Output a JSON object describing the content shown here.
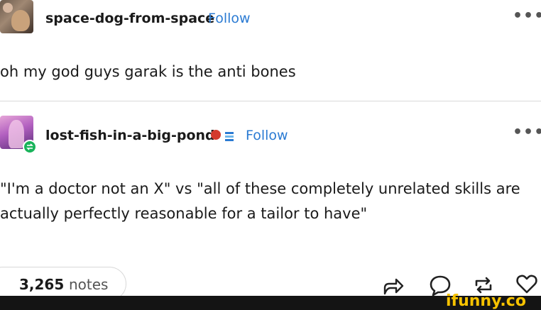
{
  "post": {
    "author": "space-dog-from-space",
    "follow_label": "Follow",
    "more_label": "•••",
    "body": "oh my god guys garak is the anti bones"
  },
  "reblog": {
    "author": "lost-fish-in-a-big-pond",
    "follow_label": "Follow",
    "more_label": "•••",
    "body_line1": "\"I'm a doctor not an X\" vs \"all of these completely unrelated skills are",
    "body_line2": "actually perfectly reasonable for a tailor to have\""
  },
  "footer": {
    "notes_count": "3,265",
    "notes_label": "notes",
    "watermark": "ifunny.co"
  },
  "icons": [
    "share-icon",
    "reply-icon",
    "reblog-icon",
    "like-icon",
    "more-icon"
  ],
  "colors": {
    "follow": "#2b7bd3",
    "reblog_badge": "#19b35a",
    "watermark": "#f6c200"
  }
}
